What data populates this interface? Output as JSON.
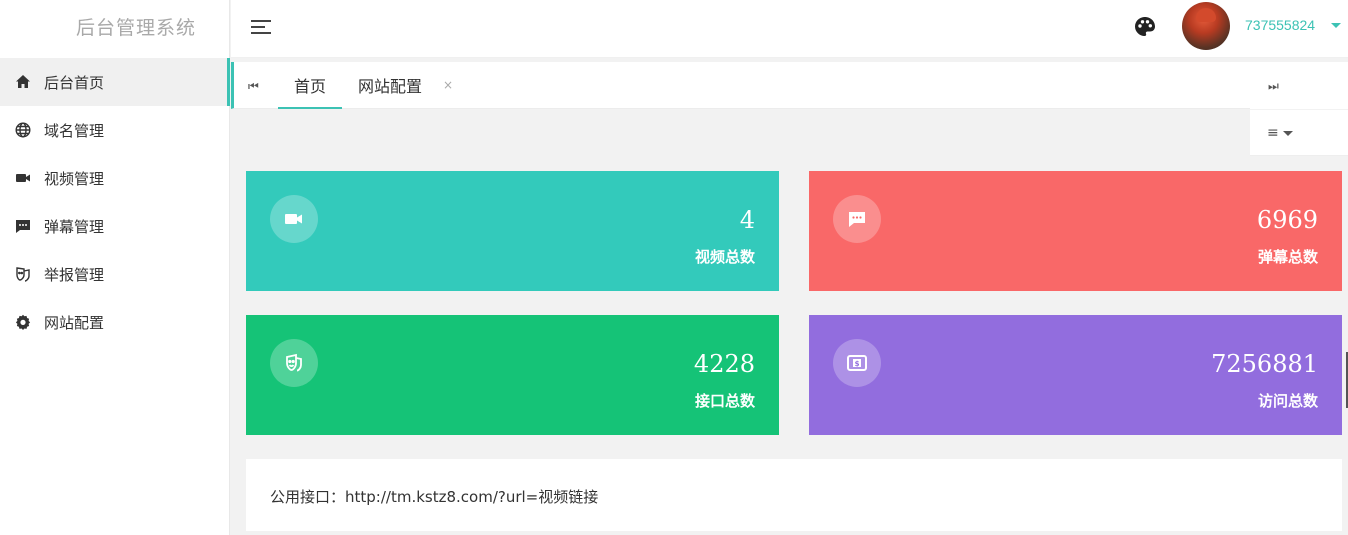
{
  "app": {
    "title": "后台管理系统"
  },
  "sidebar": {
    "items": [
      {
        "label": "后台首页",
        "icon": "home-icon",
        "active": true
      },
      {
        "label": "域名管理",
        "icon": "globe-icon"
      },
      {
        "label": "视频管理",
        "icon": "video-camera-icon"
      },
      {
        "label": "弹幕管理",
        "icon": "comment-icon"
      },
      {
        "label": "举报管理",
        "icon": "mask-icon"
      },
      {
        "label": "网站配置",
        "icon": "gear-icon"
      }
    ]
  },
  "header": {
    "menu_icon": "hamburger-icon",
    "theme_icon": "palette-icon",
    "username": "737555824"
  },
  "tabs": {
    "prev_icon": "⏮",
    "next_icon": "⏭",
    "items": [
      {
        "label": "首页",
        "active": true
      },
      {
        "label": "网站配置",
        "close": "×"
      }
    ],
    "ops_icon": "≡"
  },
  "stats": [
    {
      "value": "4",
      "label": "视频总数",
      "color": "#33cabb",
      "icon": "video-camera-icon"
    },
    {
      "value": "6969",
      "label": "弹幕总数",
      "color": "#f96868",
      "icon": "comment-icon"
    },
    {
      "value": "4228",
      "label": "接口总数",
      "color": "#15c377",
      "icon": "mask-icon"
    },
    {
      "value": "7256881",
      "label": "访问总数",
      "color": "#926dde",
      "icon": "money-icon"
    }
  ],
  "notice": {
    "text": "公用接口：http://tm.kstz8.com/?url=视频链接"
  },
  "colors": {
    "accent": "#3cc2b4"
  }
}
